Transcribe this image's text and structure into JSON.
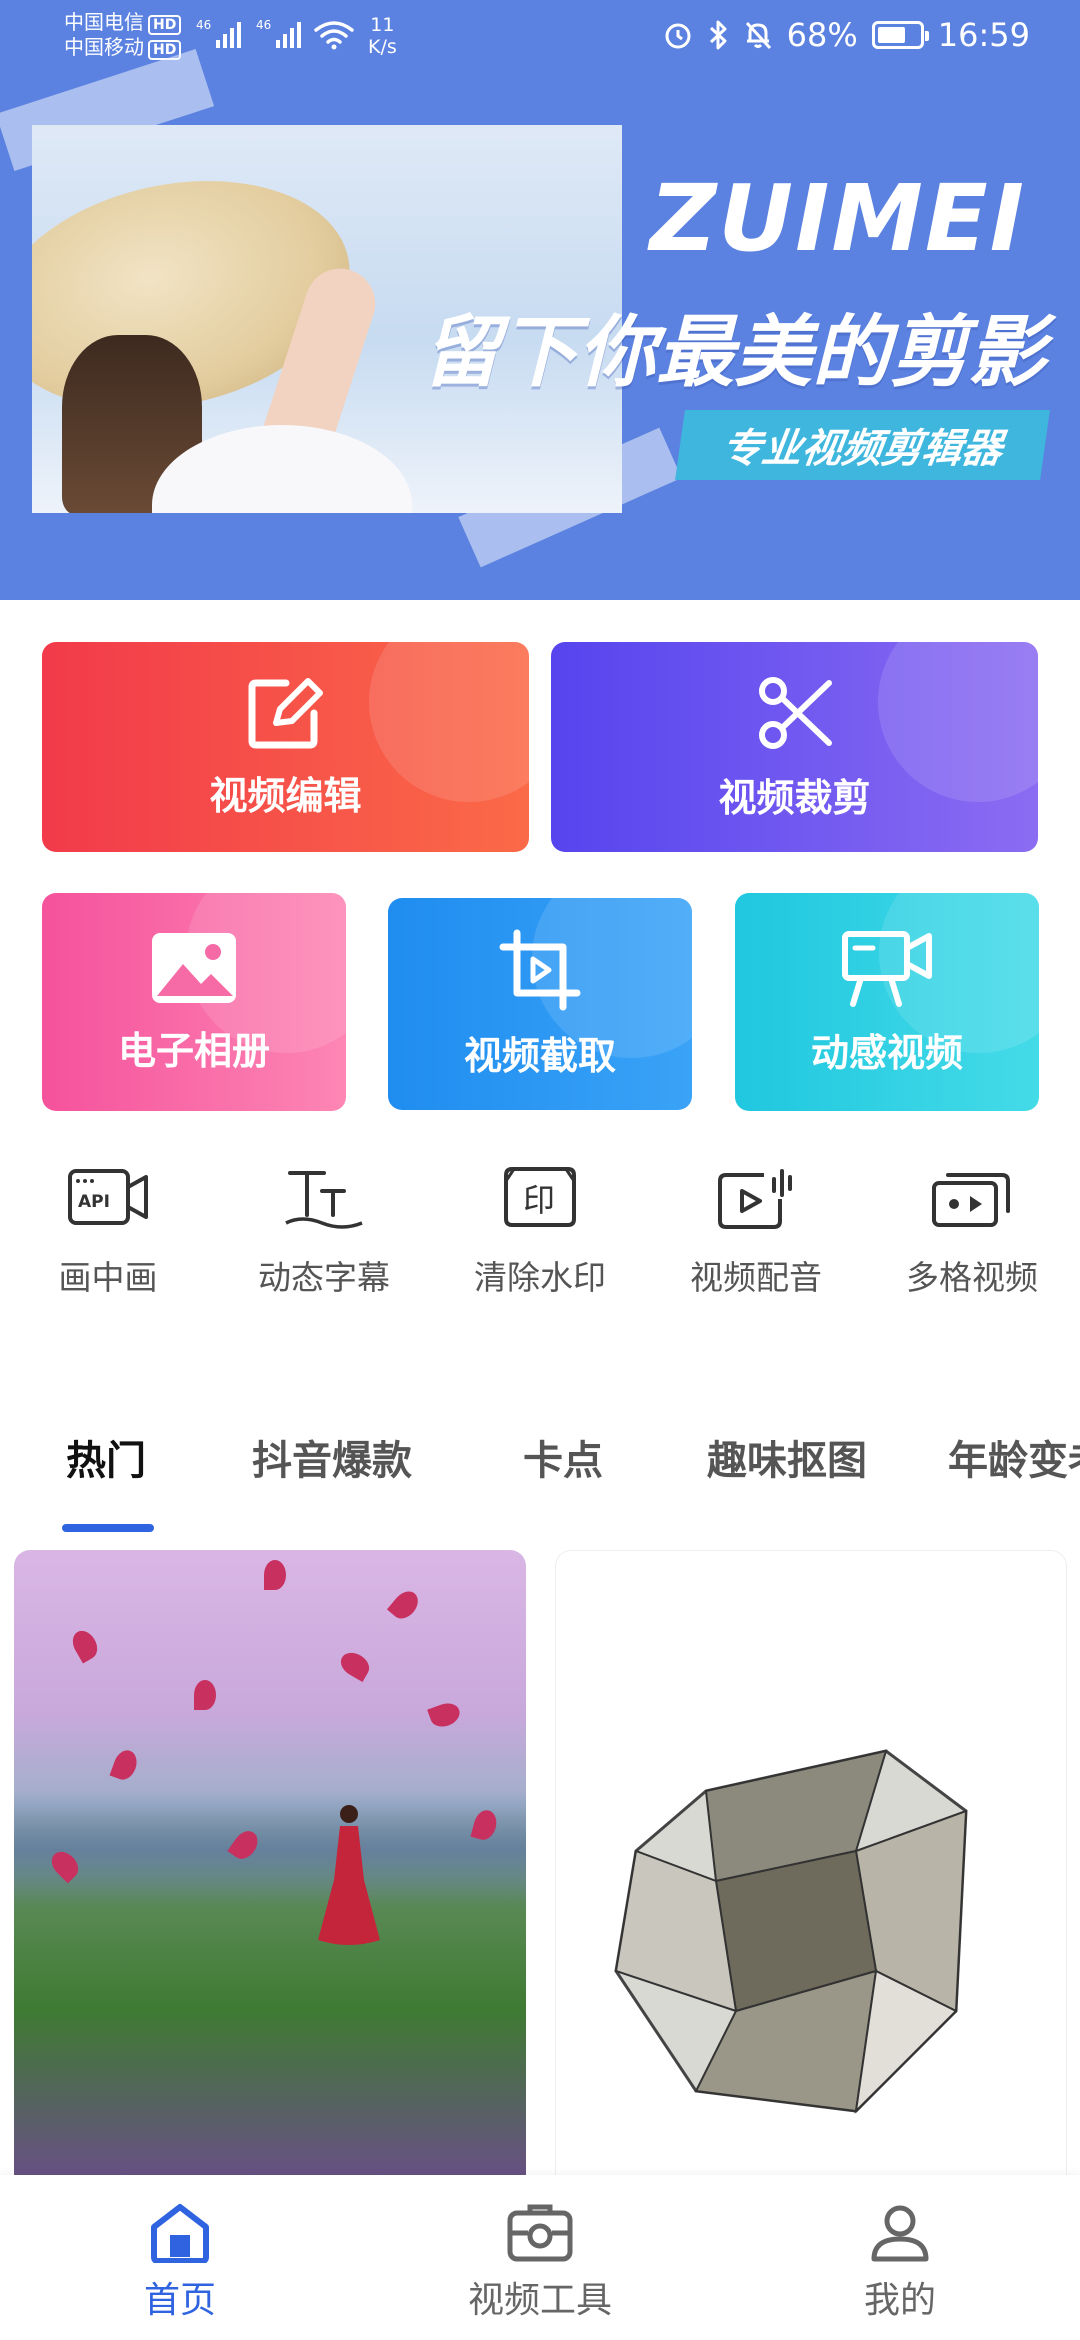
{
  "status_bar": {
    "carrier1": "中国电信",
    "carrier2": "中国移动",
    "hd": "HD",
    "net1": "46",
    "net2": "46",
    "speed_value": "11",
    "speed_unit": "K/s",
    "battery": "68%",
    "battery_level": 0.68,
    "time": "16:59"
  },
  "banner": {
    "brand": "ZUIMEI",
    "slogan": "留下你最美的剪影",
    "tagline": "专业视频剪辑器"
  },
  "features": [
    {
      "label": "视频编辑",
      "icon": "edit-icon"
    },
    {
      "label": "视频裁剪",
      "icon": "scissors-icon"
    },
    {
      "label": "电子相册",
      "icon": "image-icon"
    },
    {
      "label": "视频截取",
      "icon": "crop-play-icon"
    },
    {
      "label": "动感视频",
      "icon": "video-camera-icon"
    }
  ],
  "tools": [
    {
      "label": "画中画",
      "icon": "api-camera-icon",
      "icon_text": "API"
    },
    {
      "label": "动态字幕",
      "icon": "text-size-icon"
    },
    {
      "label": "清除水印",
      "icon": "watermark-icon",
      "icon_text": "印"
    },
    {
      "label": "视频配音",
      "icon": "video-dub-icon"
    },
    {
      "label": "多格视频",
      "icon": "multi-grid-video-icon"
    }
  ],
  "tabs": [
    "热门",
    "抖音爆款",
    "卡点",
    "趣味抠图",
    "年龄变老"
  ],
  "active_tab": 0,
  "nav": [
    {
      "label": "首页",
      "icon": "home-icon",
      "active": true
    },
    {
      "label": "视频工具",
      "icon": "toolbox-icon",
      "active": false
    },
    {
      "label": "我的",
      "icon": "user-icon",
      "active": false
    }
  ],
  "colors": {
    "banner_bg": "#5b82e0",
    "accent": "#2f63e0"
  }
}
